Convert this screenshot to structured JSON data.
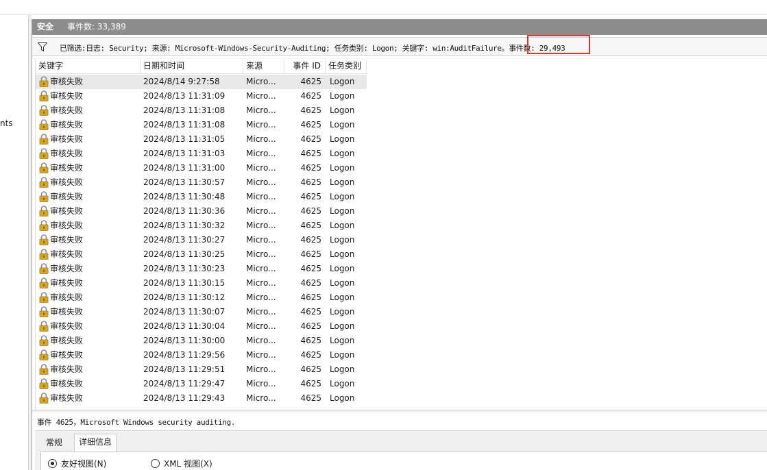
{
  "left_pane": {
    "fragment": "nts"
  },
  "log": {
    "title": "安全",
    "event_count": "事件数: 33,389"
  },
  "filter": {
    "icon": "funnel-icon",
    "text": "已筛选:日志: Security; 来源: Microsoft-Windows-Security-Auditing; 任务类别: Logon; 关键字: win:AuditFailure。事件数: 29,493"
  },
  "columns": {
    "keyword": "关键字",
    "date": "日期和时间",
    "source": "来源",
    "event_id": "事件 ID",
    "category": "任务类别"
  },
  "events": [
    {
      "keyword": "审核失败",
      "date": "2024/8/14 9:27:58",
      "source": "Micro...",
      "id": "4625",
      "category": "Logon"
    },
    {
      "keyword": "审核失败",
      "date": "2024/8/13 11:31:09",
      "source": "Micro...",
      "id": "4625",
      "category": "Logon"
    },
    {
      "keyword": "审核失败",
      "date": "2024/8/13 11:31:08",
      "source": "Micro...",
      "id": "4625",
      "category": "Logon"
    },
    {
      "keyword": "审核失败",
      "date": "2024/8/13 11:31:08",
      "source": "Micro...",
      "id": "4625",
      "category": "Logon"
    },
    {
      "keyword": "审核失败",
      "date": "2024/8/13 11:31:05",
      "source": "Micro...",
      "id": "4625",
      "category": "Logon"
    },
    {
      "keyword": "审核失败",
      "date": "2024/8/13 11:31:03",
      "source": "Micro...",
      "id": "4625",
      "category": "Logon"
    },
    {
      "keyword": "审核失败",
      "date": "2024/8/13 11:31:00",
      "source": "Micro...",
      "id": "4625",
      "category": "Logon"
    },
    {
      "keyword": "审核失败",
      "date": "2024/8/13 11:30:57",
      "source": "Micro...",
      "id": "4625",
      "category": "Logon"
    },
    {
      "keyword": "审核失败",
      "date": "2024/8/13 11:30:48",
      "source": "Micro...",
      "id": "4625",
      "category": "Logon"
    },
    {
      "keyword": "审核失败",
      "date": "2024/8/13 11:30:36",
      "source": "Micro...",
      "id": "4625",
      "category": "Logon"
    },
    {
      "keyword": "审核失败",
      "date": "2024/8/13 11:30:32",
      "source": "Micro...",
      "id": "4625",
      "category": "Logon"
    },
    {
      "keyword": "审核失败",
      "date": "2024/8/13 11:30:27",
      "source": "Micro...",
      "id": "4625",
      "category": "Logon"
    },
    {
      "keyword": "审核失败",
      "date": "2024/8/13 11:30:25",
      "source": "Micro...",
      "id": "4625",
      "category": "Logon"
    },
    {
      "keyword": "审核失败",
      "date": "2024/8/13 11:30:23",
      "source": "Micro...",
      "id": "4625",
      "category": "Logon"
    },
    {
      "keyword": "审核失败",
      "date": "2024/8/13 11:30:15",
      "source": "Micro...",
      "id": "4625",
      "category": "Logon"
    },
    {
      "keyword": "审核失败",
      "date": "2024/8/13 11:30:12",
      "source": "Micro...",
      "id": "4625",
      "category": "Logon"
    },
    {
      "keyword": "审核失败",
      "date": "2024/8/13 11:30:07",
      "source": "Micro...",
      "id": "4625",
      "category": "Logon"
    },
    {
      "keyword": "审核失败",
      "date": "2024/8/13 11:30:04",
      "source": "Micro...",
      "id": "4625",
      "category": "Logon"
    },
    {
      "keyword": "审核失败",
      "date": "2024/8/13 11:30:00",
      "source": "Micro...",
      "id": "4625",
      "category": "Logon"
    },
    {
      "keyword": "审核失败",
      "date": "2024/8/13 11:29:56",
      "source": "Micro...",
      "id": "4625",
      "category": "Logon"
    },
    {
      "keyword": "审核失败",
      "date": "2024/8/13 11:29:51",
      "source": "Micro...",
      "id": "4625",
      "category": "Logon"
    },
    {
      "keyword": "审核失败",
      "date": "2024/8/13 11:29:47",
      "source": "Micro...",
      "id": "4625",
      "category": "Logon"
    },
    {
      "keyword": "审核失败",
      "date": "2024/8/13 11:29:43",
      "source": "Micro...",
      "id": "4625",
      "category": "Logon"
    }
  ],
  "detail": {
    "title": "事件 4625，Microsoft Windows security auditing.",
    "tabs": {
      "general": "常规",
      "details": "详细信息"
    },
    "views": {
      "friendly": "友好视图(N)",
      "xml": "XML 视图(X)"
    }
  },
  "colors": {
    "title_bar": "#8d8d8d",
    "highlight_box": "#d9362c",
    "lock_gold": "#d4a72c",
    "selected_row": "#e8e8e8"
  },
  "icons": {
    "row_icon": "lock-icon"
  }
}
